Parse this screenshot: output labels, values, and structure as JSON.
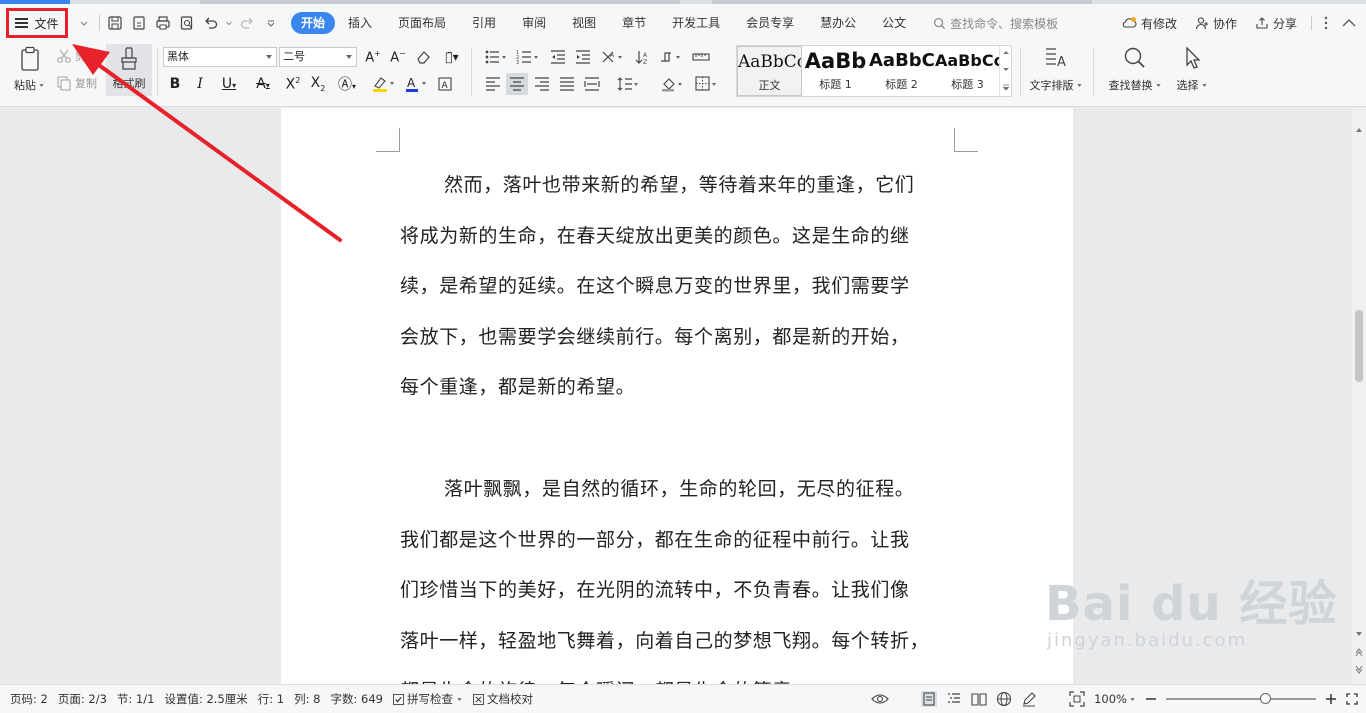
{
  "menubar": {
    "file_label": "文件",
    "tabs": [
      "开始",
      "插入",
      "页面布局",
      "引用",
      "审阅",
      "视图",
      "章节",
      "开发工具",
      "会员专享",
      "慧办公",
      "公文"
    ],
    "active_tab_index": 0,
    "search_placeholder": "查找命令、搜索模板",
    "right": {
      "modify": "有修改",
      "collab": "协作",
      "share": "分享"
    }
  },
  "ribbon": {
    "paste_label": "粘贴",
    "cut_label": "剪切",
    "copy_label": "复制",
    "format_painter_label": "格式刷",
    "font_name": "黑体",
    "font_size": "二号",
    "styles": [
      {
        "preview": "AaBbCcDd",
        "name": "正文"
      },
      {
        "preview": "AaBb",
        "name": "标题 1"
      },
      {
        "preview": "AaBbC",
        "name": "标题 2"
      },
      {
        "preview": "AaBbCc",
        "name": "标题 3"
      }
    ],
    "text_layout_label": "文字排版",
    "find_replace_label": "查找替换",
    "select_label": "选择"
  },
  "document": {
    "paragraph1": [
      "然而，落叶也带来新的希望，等待着来年的重逢，它们",
      "将成为新的生命，在春天绽放出更美的颜色。这是生命的继",
      "续，是希望的延续。在这个瞬息万变的世界里，我们需要学",
      "会放下，也需要学会继续前行。每个离别，都是新的开始，",
      "每个重逢，都是新的希望。"
    ],
    "paragraph2": [
      "落叶飘飘，是自然的循环，生命的轮回，无尽的征程。",
      "我们都是这个世界的一部分，都在生命的征程中前行。让我",
      "们珍惜当下的美好，在光阴的流转中，不负青春。让我们像",
      "落叶一样，轻盈地飞舞着，向着自己的梦想飞翔。每个转折，",
      "都是生命的旋律，每个瞬间，都是生命的篇章。"
    ]
  },
  "watermark": {
    "main": "Bai du 经验",
    "sub": "jingyan.baidu.com"
  },
  "statusbar": {
    "page_no": "页码: 2",
    "pages": "页面: 2/3",
    "section": "节: 1/1",
    "setting": "设置值: 2.5厘米",
    "row": "行: 1",
    "col": "列: 8",
    "word_count": "字数: 649",
    "spell_check": "拼写检查",
    "doc_check": "文档校对",
    "zoom": "100%"
  },
  "colors": {
    "accent": "#3a86ef",
    "highlight": "#e8222a"
  }
}
